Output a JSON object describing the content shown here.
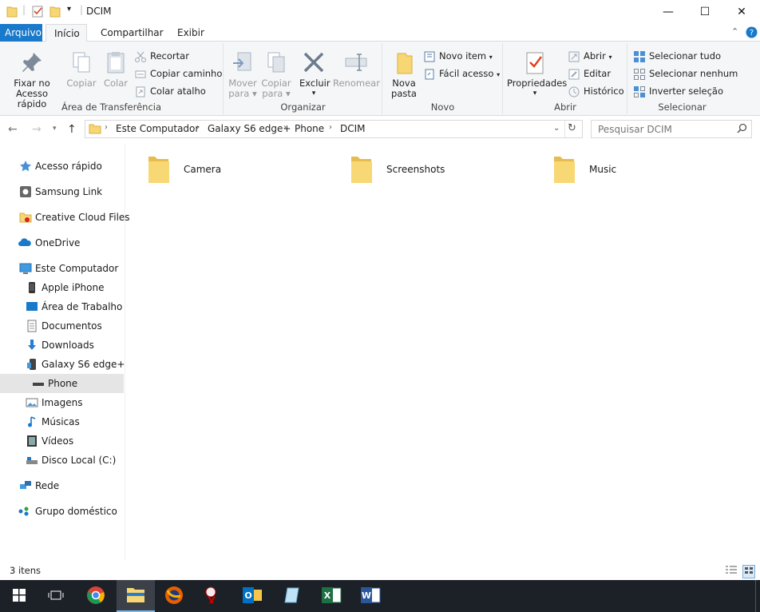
{
  "window": {
    "title": "DCIM",
    "minimize_label": "—",
    "maximize_label": "☐",
    "close_label": "✕"
  },
  "ribbon_tabs": [
    {
      "label": "Arquivo"
    },
    {
      "label": "Início"
    },
    {
      "label": "Compartilhar"
    },
    {
      "label": "Exibir"
    }
  ],
  "ribbon": {
    "clipboard": {
      "pin_label_1": "Fixar no",
      "pin_label_2": "Acesso rápido",
      "copy_label": "Copiar",
      "paste_label": "Colar",
      "cut_label": "Recortar",
      "copy_path_label": "Copiar caminho",
      "paste_shortcut_label": "Colar atalho",
      "group_label": "Área de Transferência"
    },
    "organize": {
      "move_label_1": "Mover",
      "move_label_2": "para",
      "copyto_label_1": "Copiar",
      "copyto_label_2": "para",
      "delete_label": "Excluir",
      "rename_label": "Renomear",
      "group_label": "Organizar"
    },
    "new": {
      "new_folder_label_1": "Nova",
      "new_folder_label_2": "pasta",
      "new_item_label": "Novo item",
      "easy_access_label": "Fácil acesso",
      "group_label": "Novo"
    },
    "open": {
      "properties_label": "Propriedades",
      "open_label": "Abrir",
      "edit_label": "Editar",
      "history_label": "Histórico",
      "group_label": "Abrir"
    },
    "select": {
      "select_all_label": "Selecionar tudo",
      "select_none_label": "Selecionar nenhum",
      "invert_label": "Inverter seleção",
      "group_label": "Selecionar"
    }
  },
  "address": {
    "crumbs": [
      "Este Computador",
      "Galaxy S6 edge+",
      "Phone",
      "DCIM"
    ],
    "sep": "›"
  },
  "search": {
    "placeholder": "Pesquisar DCIM"
  },
  "sidebar": {
    "items": [
      {
        "label": "Acesso rápido",
        "icon": "star-icon"
      },
      {
        "label": "Samsung Link",
        "icon": "samsung-link-icon"
      },
      {
        "label": "Creative Cloud Files",
        "icon": "creative-cloud-icon"
      },
      {
        "label": "OneDrive",
        "icon": "cloud-icon"
      },
      {
        "label": "Este Computador",
        "icon": "computer-icon"
      },
      {
        "label": "Apple iPhone",
        "icon": "phone-icon"
      },
      {
        "label": "Área de Trabalho",
        "icon": "desktop-icon"
      },
      {
        "label": "Documentos",
        "icon": "document-icon"
      },
      {
        "label": "Downloads",
        "icon": "download-icon"
      },
      {
        "label": "Galaxy S6 edge+",
        "icon": "phone-icon"
      },
      {
        "label": "Phone",
        "icon": "drive-icon"
      },
      {
        "label": "Imagens",
        "icon": "pictures-icon"
      },
      {
        "label": "Músicas",
        "icon": "music-icon"
      },
      {
        "label": "Vídeos",
        "icon": "video-icon"
      },
      {
        "label": "Disco Local (C:)",
        "icon": "disk-icon"
      },
      {
        "label": "Rede",
        "icon": "network-icon"
      },
      {
        "label": "Grupo doméstico",
        "icon": "homegroup-icon"
      }
    ]
  },
  "content": {
    "folders": [
      {
        "name": "Camera"
      },
      {
        "name": "Screenshots"
      },
      {
        "name": "Music"
      }
    ]
  },
  "status": {
    "count": "3 itens"
  },
  "colors": {
    "accent": "#1979ca",
    "folder": "#f7d774",
    "taskbar": "#1c2027"
  }
}
